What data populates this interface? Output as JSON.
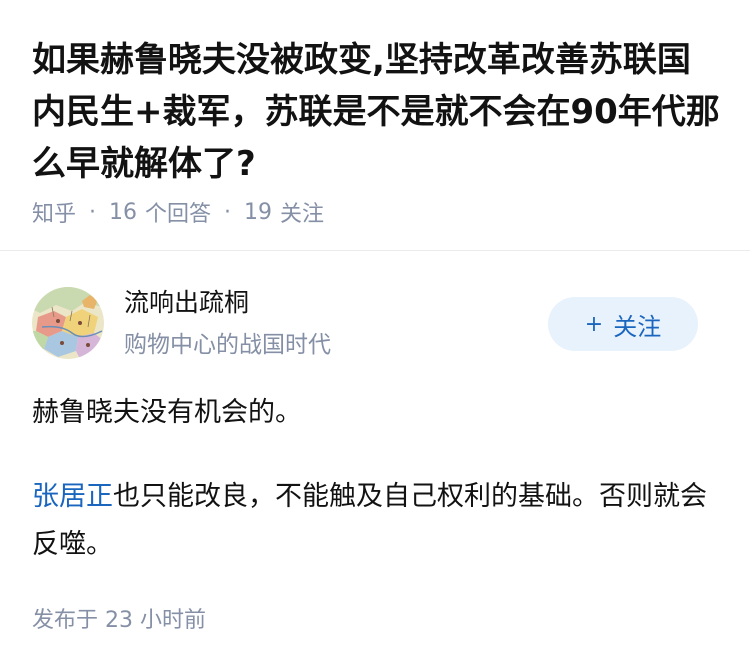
{
  "question": {
    "title": "如果赫鲁晓夫没被政变,坚持改革改善苏联国内民生+裁军，苏联是不是就不会在90年代那么早就解体了?",
    "source": "知乎",
    "answer_count": "16",
    "answer_label": "个回答",
    "follower_count": "19",
    "follower_label": "关注",
    "separator": "·"
  },
  "answer": {
    "author": {
      "name": "流响出疏桐",
      "bio": "购物中心的战国时代",
      "avatar_icon": "map-avatar"
    },
    "follow_button": {
      "plus": "+",
      "label": "关注"
    },
    "paragraphs": {
      "p1": "赫鲁晓夫没有机会的。",
      "p2_link": "张居正",
      "p2_rest": "也只能改良，不能触及自己权利的基础。否则就会反噬。"
    },
    "published": "发布于 23 小时前"
  },
  "colors": {
    "title": "#121212",
    "meta": "#8590a6",
    "link": "#1a66bf",
    "follow_bg": "#e8f2fc"
  }
}
